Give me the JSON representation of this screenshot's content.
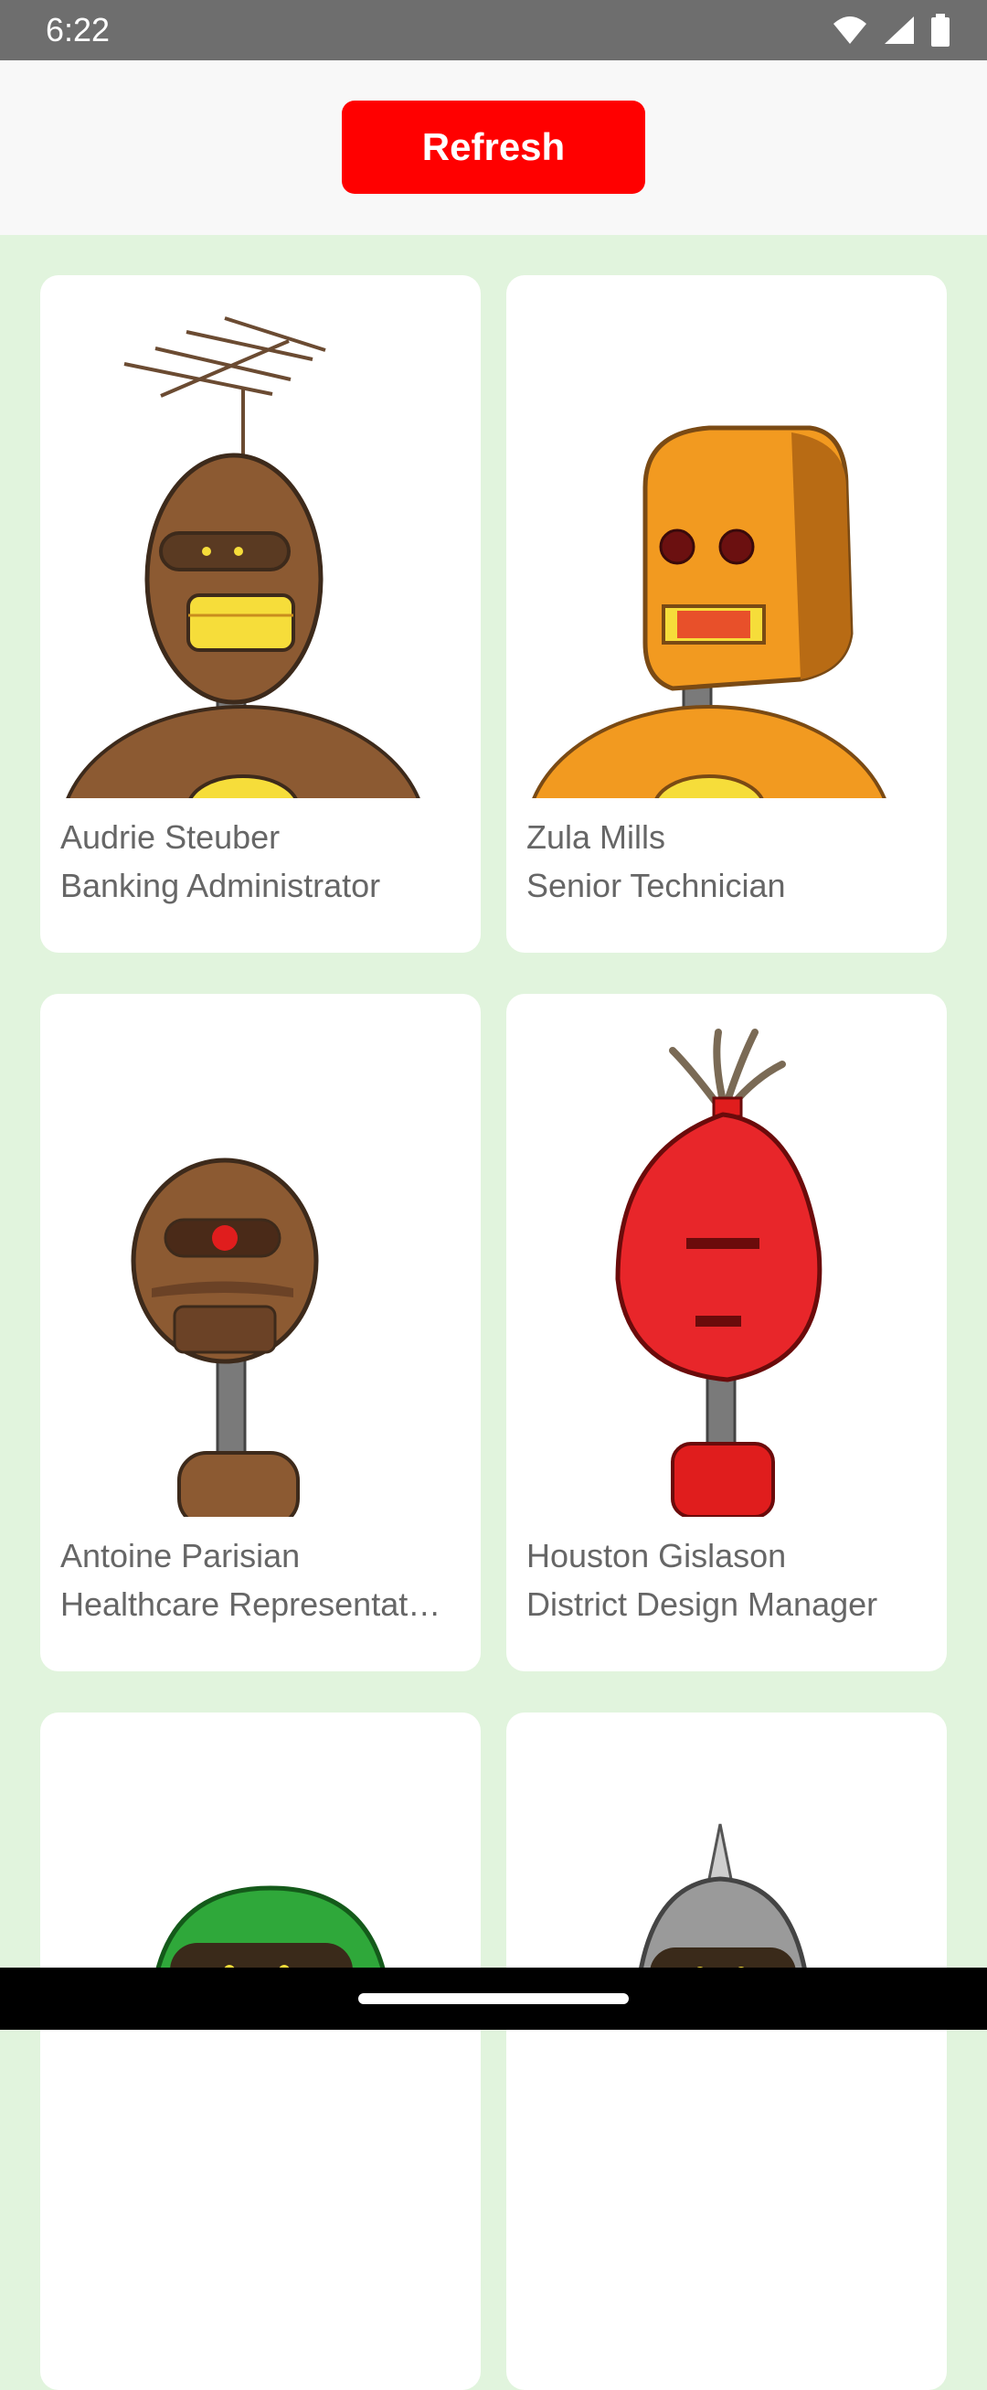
{
  "status_bar": {
    "time": "6:22",
    "icons": [
      "wifi-icon",
      "signal-icon",
      "battery-icon"
    ]
  },
  "toolbar": {
    "refresh_label": "Refresh",
    "refresh_color": "#ff0000"
  },
  "cards": [
    {
      "name": "Audrie Steuber",
      "role": "Banking Administrator",
      "robot": "brown-antenna-robot"
    },
    {
      "name": "Zula Mills",
      "role": "Senior Technician",
      "robot": "orange-box-robot"
    },
    {
      "name": "Antoine Parisian",
      "role": "Healthcare Representat…",
      "robot": "brown-cyclops-robot"
    },
    {
      "name": "Houston Gislason",
      "role": "District Design Manager",
      "robot": "red-feather-robot"
    },
    {
      "name": "",
      "role": "",
      "robot": "green-helmet-robot"
    },
    {
      "name": "",
      "role": "",
      "robot": "silver-spike-robot"
    }
  ],
  "colors": {
    "background": "#e1f4dd",
    "card": "#ffffff",
    "text": "#666666"
  }
}
